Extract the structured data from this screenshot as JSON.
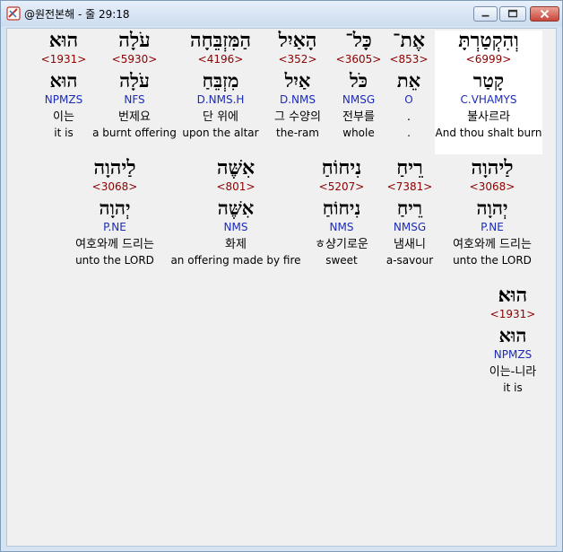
{
  "window": {
    "title": "@원전본해 - 줄 29:18",
    "icon": "bible-app-icon"
  },
  "words": [
    {
      "heb": "וְהִקְטַרְתָּ",
      "strong": "<6999>",
      "root": "קָטַר",
      "morph": "C.VHAMYS",
      "kor": "불사르라",
      "eng": "And thou shalt burn",
      "selected": true
    },
    {
      "heb": "אֶת־",
      "strong": "<853>",
      "root": "אֵת",
      "morph": "O",
      "kor": ".",
      "eng": "."
    },
    {
      "heb": "כָּל־",
      "strong": "<3605>",
      "root": "כֹּל",
      "morph": "NMSG",
      "kor": "전부를",
      "eng": "whole"
    },
    {
      "heb": "הָאַיִל",
      "strong": "<352>",
      "root": "אַיִל",
      "morph": "D.NMS",
      "kor": "그 수양의",
      "eng": "the-ram"
    },
    {
      "heb": "הַמִּזְבֵּחָה",
      "strong": "<4196>",
      "root": "מִזְבֵּחַ",
      "morph": "D.NMS.H",
      "kor": "단 위에",
      "eng": "upon the altar"
    },
    {
      "heb": "עֹלָה",
      "strong": "<5930>",
      "root": "עֹלָה",
      "morph": "NFS",
      "kor": "번제요",
      "eng": "a burnt offering"
    },
    {
      "heb": "הוּא",
      "strong": "<1931>",
      "root": "הוּא",
      "morph": "NPMZS",
      "kor": "이는",
      "eng": "it is"
    },
    {
      "heb": "לַיהוָה",
      "strong": "<3068>",
      "root": "יְהוָה",
      "morph": "P.NE",
      "kor": "여호와께 드리는",
      "eng": "unto the LORD"
    },
    {
      "heb": "רֵיחַ",
      "strong": "<7381>",
      "root": "רֵיחַ",
      "morph": "NMSG",
      "kor": "냄새니",
      "eng": "a-savour"
    },
    {
      "heb": "נִיחוֹחַ",
      "strong": "<5207>",
      "root": "נִיחוֹחַ",
      "morph": "NMS",
      "kor": "ㅎ샹기로운",
      "eng": "sweet"
    },
    {
      "heb": "אִשֶּׁה",
      "strong": "<801>",
      "root": "אִשֶּׁה",
      "morph": "NMS",
      "kor": "화제",
      "eng": "an offering made by fire"
    },
    {
      "heb": "לַיהוָה",
      "strong": "<3068>",
      "root": "יְהוָה",
      "morph": "P.NE",
      "kor": "여호와께 드리는",
      "eng": "unto the LORD"
    },
    {
      "heb": "הוּא׃",
      "strong": "<1931>",
      "root": "הוּא",
      "morph": "NPMZS",
      "kor": "이는-니라",
      "eng": "it is"
    }
  ]
}
